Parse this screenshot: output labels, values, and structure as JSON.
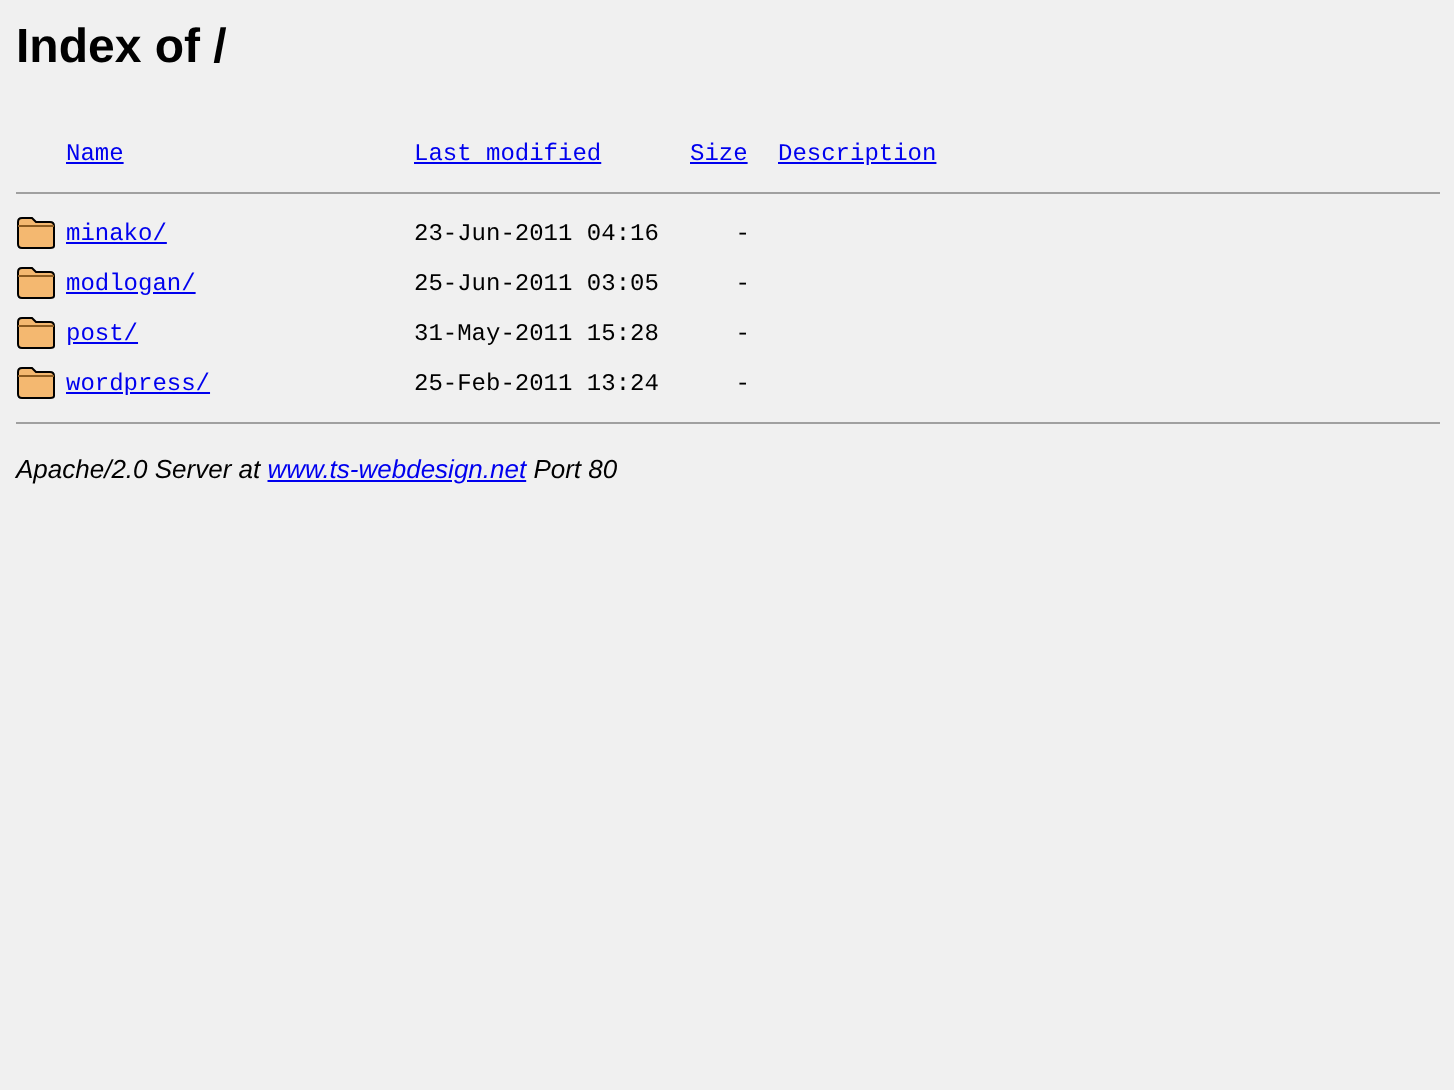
{
  "title": "Index of /",
  "columns": [
    "Name",
    "Last modified",
    "Size",
    "Description"
  ],
  "rows": [
    {
      "name": "minako/",
      "modified": "23-Jun-2011 04:16",
      "size": "-"
    },
    {
      "name": "modlogan/",
      "modified": "25-Jun-2011 03:05",
      "size": "-"
    },
    {
      "name": "post/",
      "modified": "31-May-2011 15:28",
      "size": "-"
    },
    {
      "name": "wordpress/",
      "modified": "25-Feb-2011 13:24",
      "size": "-"
    }
  ],
  "footer": {
    "before": "Apache/2.0 Server at ",
    "link": "www.ts-webdesign.net",
    "after": " Port 80"
  }
}
